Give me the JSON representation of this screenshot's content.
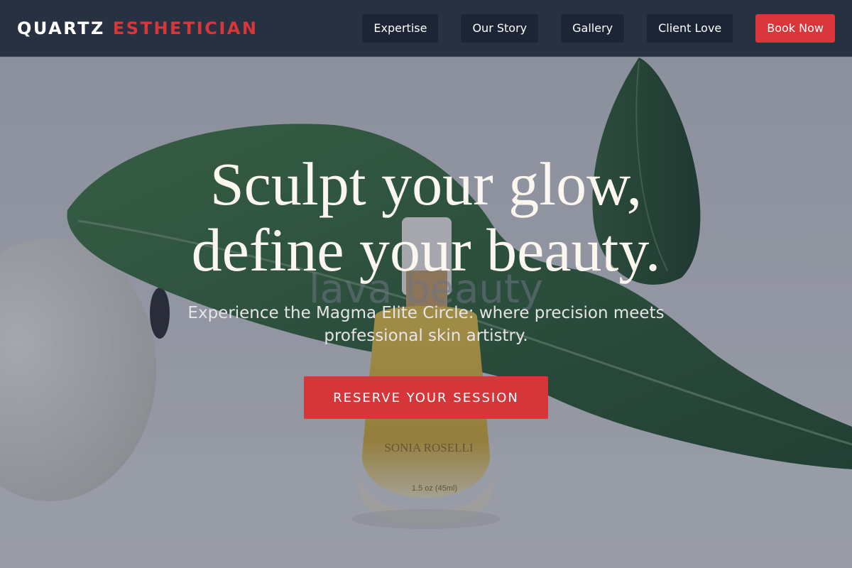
{
  "header": {
    "logo_primary": "QUARTZ",
    "logo_accent": "ESTHETICIAN",
    "nav": [
      "Expertise",
      "Our Story",
      "Gallery",
      "Client Love"
    ],
    "cta_label": "Book Now"
  },
  "hero": {
    "headline_line1": "Sculpt your glow,",
    "headline_line2": "define your beauty.",
    "subhead": "Experience the Magma Elite Circle: where precision meets professional skin artistry.",
    "cta_label": "RESERVE YOUR SESSION",
    "background": {
      "watermark_text": "lava beauty",
      "bottle_brand": "SONIA ROSELLI",
      "bottle_volume": "1.5 oz (45ml)"
    }
  },
  "colors": {
    "header_bg": "#273141",
    "accent": "#d9363a",
    "nav_item_bg": "#1c2535"
  }
}
